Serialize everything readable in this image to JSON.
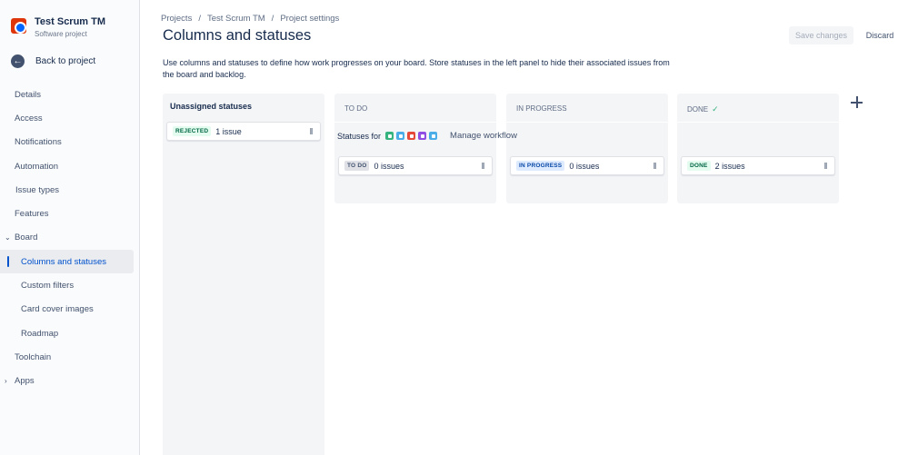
{
  "project": {
    "name": "Test Scrum TM",
    "type": "Software project"
  },
  "back_label": "Back to project",
  "nav": {
    "details": "Details",
    "access": "Access",
    "notifications": "Notifications",
    "automation": "Automation",
    "issue_types": "Issue types",
    "features": "Features",
    "board": "Board",
    "columns_statuses": "Columns and statuses",
    "custom_filters": "Custom filters",
    "card_cover_images": "Card cover images",
    "roadmap": "Roadmap",
    "toolchain": "Toolchain",
    "apps": "Apps"
  },
  "breadcrumbs": {
    "projects": "Projects",
    "project": "Test Scrum TM",
    "settings": "Project settings",
    "separator": "/"
  },
  "page_title": "Columns and statuses",
  "buttons": {
    "save": "Save changes",
    "discard": "Discard"
  },
  "description": "Use columns and statuses to define how work progresses on your board. Store statuses in the left panel to hide their associated issues from the board and backlog.",
  "unassigned": {
    "title": "Unassigned statuses",
    "card": {
      "status": "REJECTED",
      "count": "1 issue"
    }
  },
  "statuses_for": {
    "label": "Statuses for",
    "manage": "Manage workflow",
    "issue_types": [
      "story-icon",
      "task-icon",
      "bug-icon",
      "epic-icon",
      "subtask-icon"
    ]
  },
  "columns": [
    {
      "title": "TO DO",
      "card": {
        "status": "TO DO",
        "count": "0 issues"
      }
    },
    {
      "title": "IN PROGRESS",
      "card": {
        "status": "IN PROGRESS",
        "count": "0 issues"
      }
    },
    {
      "title": "DONE",
      "done_icon": "✓",
      "card": {
        "status": "DONE",
        "count": "2 issues"
      }
    }
  ],
  "colors": {
    "accent": "#0052CC",
    "done_green": "#006644",
    "in_progress_blue": "#0747A6"
  }
}
